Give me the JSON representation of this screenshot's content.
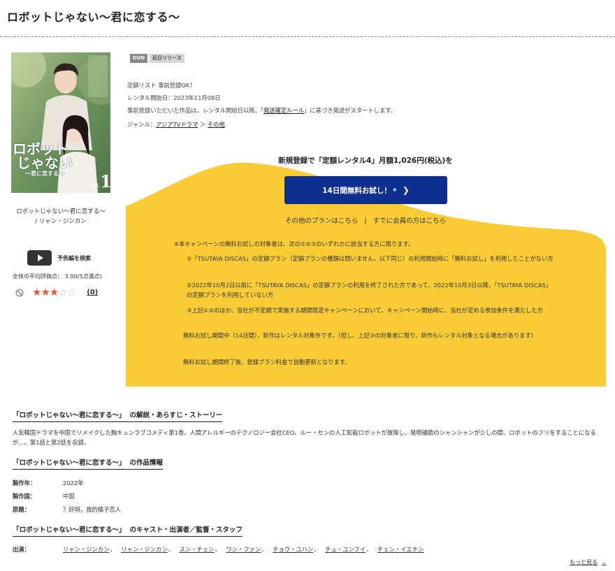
{
  "title": "ロボットじゃない〜君に恋する〜",
  "left": {
    "cover_title_line1": "ロボットじゃない〜君に恋する〜",
    "cover_title_line2": "/ リャン・ジンカン",
    "cover_logo_main": "ロボット",
    "cover_logo_sub": "じゃない",
    "cover_logo_small": "〜君に恋する〜",
    "cover_vol_label": "Vol.",
    "cover_vol": "1",
    "trailer_label": "予告編を検索",
    "rating_text": "全体の平均評価点：  3.00(5点満点)",
    "rating_value": 3,
    "rating_max": 5,
    "star_full": "★",
    "star_empty": "☆",
    "review_count": "(0)"
  },
  "badges": [
    "DVD",
    "近日リリース"
  ],
  "info": {
    "line1": "定額リスト 事前登録OK！",
    "line2": "レンタル開始日：2023年11月08日",
    "line3_before": "事前登録いただいた作品は、レンタル開始日以降、「",
    "line3_link": "発送確定ルール",
    "line3_after": "」に基づき発送がスタートします。",
    "genre_label": "ジャンル：",
    "genre_1": "アジアTVドラマ",
    "genre_arrow": "＞",
    "genre_2": "その他"
  },
  "campaign": {
    "headline": "新規登録で「定額レンタル4」月額1,026円(税込)を",
    "cta_label": "14日間無料お試し！",
    "cta_mark": "※",
    "cta_chevron": "❯",
    "link_other_plans": "その他のプランはこちら",
    "link_separator": "|",
    "link_member": "すでに会員の方はこちら",
    "notice_intro": "※本キャンペーンの無料お試しの対象者は、次の①②③のいずれかに該当する方に限ります。",
    "cond1": "①「TSUTAYA DISCAS」の定額プラン（定額プランの種類は問いません。以下同じ）の利用開始時に「無料お試し」を利用したことがない方",
    "cond2": "②2022年10月2日以前に「TSUTAYA DISCAS」の定額プランの利用を終了された方であって、2022年10月3日以降、「TSUTAYA DISCAS」の定額プランを利用していない方",
    "cond3": "③上記①②のほか、当社が不定期で実施する期間限定キャンペーンにおいて、キャンペーン開始時に、当社が定める参加条件を満たした方",
    "note1": "無料お試し期間中（14日間）、新作はレンタル対象外です。（但し、上記③の対象者に限り、新作もレンタル対象となる場合があります）",
    "note2": "無料お試し期間終了後、登録プラン料金で自動更新となります。",
    "blob_color": "#f9cb35"
  },
  "sections": {
    "synopsis_quote": "「ロボットじゃない〜君に恋する〜」",
    "synopsis_tag": "の解説・あらすじ・ストーリー",
    "synopsis_text": "人気韓国ドラマを中国でリメイクした胸キュンラブコメディ第1巻。人間アレルギーのテクノロジー会社CEO、ルー・センの人工知能ロボットが故障し、発明補助のシャンシャンが少しの間、ロボットのフリをすることになるが…。第1話と第2話を収録。",
    "info_quote": "「ロボットじゃない〜君に恋する〜」",
    "info_tag": "の作品情報",
    "year_label": "製作年：",
    "year_value": "2022年",
    "country_label": "製作国：",
    "country_value": "中国",
    "original_label": "原題：",
    "original_value": "？好呀，我的橘子恋人",
    "cast_quote": "「ロボットじゃない〜君に恋する〜」",
    "cast_tag": "のキャスト・出演者／監督・スタッフ",
    "cast_label": "出演：",
    "cast": [
      "リャン・ジンカン",
      "リャン・ジンカン",
      "スン・チェン",
      "ワン・ファン",
      "チョウ・ユハン",
      "チュ・ユンフイ",
      "チェン・イエチン"
    ],
    "cast_comma": "、",
    "more_label": "もっと見る",
    "more_chevron": "⌄"
  }
}
